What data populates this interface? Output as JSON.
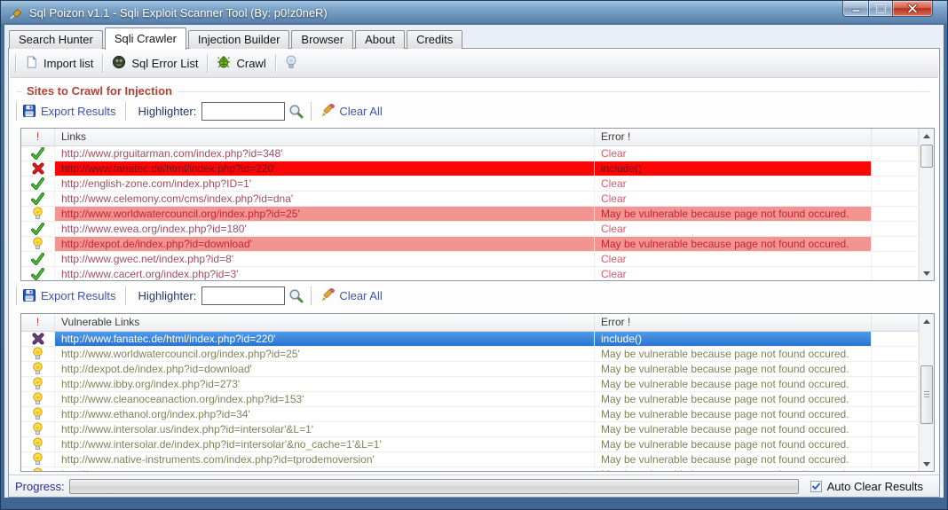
{
  "window": {
    "title": "Sql Poizon v1.1 - Sqli Exploit Scanner Tool (By: p0!z0neR)"
  },
  "tabs": [
    {
      "label": "Search Hunter",
      "active": false
    },
    {
      "label": "Sqli Crawler",
      "active": true
    },
    {
      "label": "Injection Builder",
      "active": false
    },
    {
      "label": "Browser",
      "active": false
    },
    {
      "label": "About",
      "active": false
    },
    {
      "label": "Credits",
      "active": false
    }
  ],
  "toolbar": {
    "import_label": "Import list",
    "sql_error_label": "Sql Error List",
    "crawl_label": "Crawl"
  },
  "group_title": "Sites to Crawl for Injection",
  "crawl_section": {
    "export_label": "Export Results",
    "highlighter_label": "Highlighter:",
    "highlighter_value": "",
    "clear_all_label": "Clear All"
  },
  "vuln_section": {
    "export_label": "Export Results",
    "highlighter_label": "Highlighter:",
    "highlighter_value": "",
    "clear_all_label": "Clear All"
  },
  "table1": {
    "headers": {
      "flag": "!",
      "links": "Links",
      "error": "Error !"
    },
    "rows": [
      {
        "icon": "check",
        "link": "http://www.prguitarman.com/index.php?id=348'",
        "error": "Clear",
        "state": "normal"
      },
      {
        "icon": "cross",
        "link": "http://www.fanatec.de/html/index.php?id=220'",
        "error": "include()",
        "state": "error"
      },
      {
        "icon": "check",
        "link": "http://english-zone.com/index.php?ID=1'",
        "error": "Clear",
        "state": "normal"
      },
      {
        "icon": "check",
        "link": "http://www.celemony.com/cms/index.php?id=dna'",
        "error": "Clear",
        "state": "normal"
      },
      {
        "icon": "bulb",
        "link": "http://www.worldwatercouncil.org/index.php?id=25'",
        "error": "May be vulnerable because page not found occured.",
        "state": "warning"
      },
      {
        "icon": "check",
        "link": "http://www.ewea.org/index.php?id=180'",
        "error": "Clear",
        "state": "normal"
      },
      {
        "icon": "bulb",
        "link": "http://dexpot.de/index.php?id=download'",
        "error": "May be vulnerable because page not found occured.",
        "state": "warning"
      },
      {
        "icon": "check",
        "link": "http://www.gwec.net/index.php?id=8'",
        "error": "Clear",
        "state": "normal"
      },
      {
        "icon": "check",
        "link": "http://www.cacert.org/index.php?id=3'",
        "error": "Clear",
        "state": "normal"
      }
    ]
  },
  "table2": {
    "headers": {
      "flag": "!",
      "links": "Vulnerable Links",
      "error": "Error !"
    },
    "rows": [
      {
        "icon": "cross",
        "link": "http://www.fanatec.de/html/index.php?id=220'",
        "error": "include()",
        "state": "selected"
      },
      {
        "icon": "bulb",
        "link": "http://www.worldwatercouncil.org/index.php?id=25'",
        "error": "May be vulnerable because page not found occured.",
        "state": "normal"
      },
      {
        "icon": "bulb",
        "link": "http://dexpot.de/index.php?id=download'",
        "error": "May be vulnerable because page not found occured.",
        "state": "normal"
      },
      {
        "icon": "bulb",
        "link": "http://www.ibby.org/index.php?id=273'",
        "error": "May be vulnerable because page not found occured.",
        "state": "normal"
      },
      {
        "icon": "bulb",
        "link": "http://www.cleanoceanaction.org/index.php?id=153'",
        "error": "May be vulnerable because page not found occured.",
        "state": "normal"
      },
      {
        "icon": "bulb",
        "link": "http://www.ethanol.org/index.php?id=34'",
        "error": "May be vulnerable because page not found occured.",
        "state": "normal"
      },
      {
        "icon": "bulb",
        "link": "http://www.intersolar.us/index.php?id=intersolar'&L=1'",
        "error": "May be vulnerable because page not found occured.",
        "state": "normal"
      },
      {
        "icon": "bulb",
        "link": "http://www.intersolar.de/index.php?id=intersolar'&no_cache=1'&L=1'",
        "error": "May be vulnerable because page not found occured.",
        "state": "normal"
      },
      {
        "icon": "bulb",
        "link": "http://www.native-instruments.com/index.php?id=tprodemoversion'",
        "error": "May be vulnerable because page not found occured.",
        "state": "normal"
      },
      {
        "icon": "bulb",
        "link": "http://www.",
        "error": "May be vulnerable because page not found occured.",
        "state": "normal"
      }
    ]
  },
  "status": {
    "progress_label": "Progress:",
    "auto_clear_label": "Auto Clear Results",
    "auto_clear_checked": true
  },
  "colors": {
    "action_link_blue": "#3c54ae",
    "group_title_red": "#b04337",
    "row_error_bg": "#fb0606",
    "row_warning_bg": "#f29490",
    "row_selected_bg": "#2a74d2",
    "table1_link_text": "#a34e62",
    "table2_link_text": "#82825a"
  }
}
